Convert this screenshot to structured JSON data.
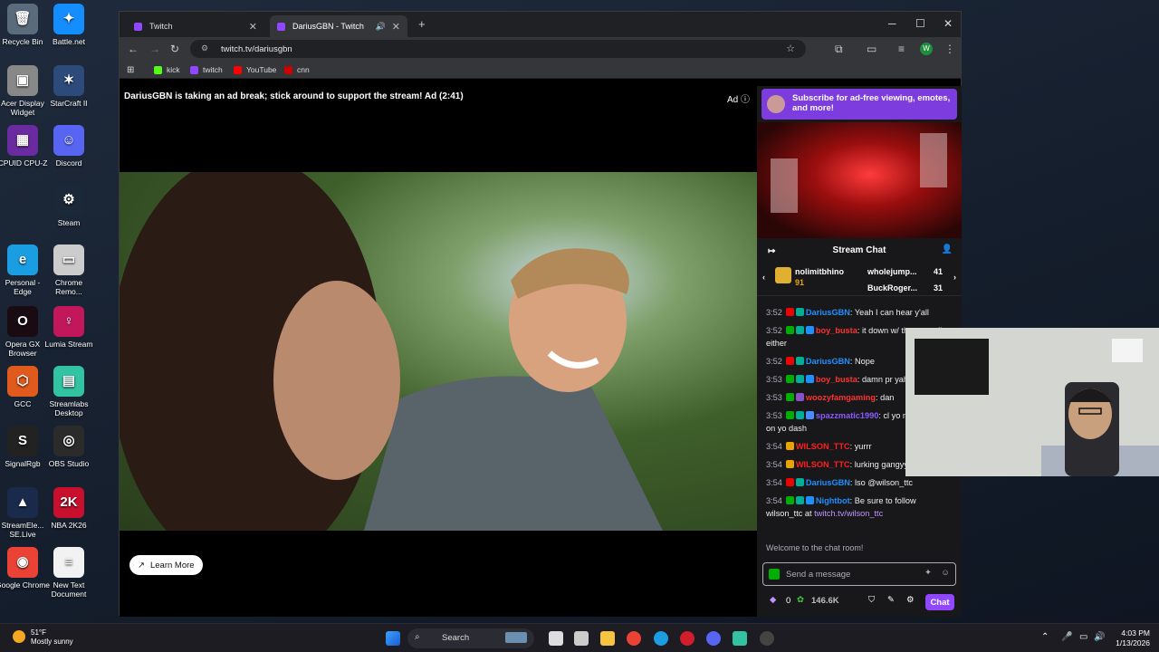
{
  "desktop": {
    "icons": [
      {
        "label": "Recycle Bin",
        "color": "#5a6b7d",
        "glyph": "🗑"
      },
      {
        "label": "Battle.net",
        "color": "#148eff",
        "glyph": "✦"
      },
      {
        "label": "Acer Display Widget",
        "color": "#888888",
        "glyph": "▣"
      },
      {
        "label": "StarCraft II",
        "color": "#2c4a7a",
        "glyph": "✶"
      },
      {
        "label": "CPUID CPU-Z",
        "color": "#6a2aa0",
        "glyph": "▦"
      },
      {
        "label": "Discord",
        "color": "#5865f2",
        "glyph": "☺"
      },
      {
        "label": "Steam",
        "color": "#1b2838",
        "glyph": "⚙"
      },
      {
        "label": "Personal - Edge",
        "color": "#1b9de2",
        "glyph": "e"
      },
      {
        "label": "Chrome Remo...",
        "color": "#cccccc",
        "glyph": "▭"
      },
      {
        "label": "Opera GX Browser",
        "color": "#1a0b12",
        "glyph": "O"
      },
      {
        "label": "Lumia Stream",
        "color": "#c2185b",
        "glyph": "♀"
      },
      {
        "label": "GCC",
        "color": "#e05a1e",
        "glyph": "⬡"
      },
      {
        "label": "Streamlabs Desktop",
        "color": "#31c3a2",
        "glyph": "▤"
      },
      {
        "label": "SignalRgb",
        "color": "#222222",
        "glyph": "S"
      },
      {
        "label": "OBS Studio",
        "color": "#2b2b2b",
        "glyph": "◎"
      },
      {
        "label": "StreamEle... SE.Live",
        "color": "#1a2a4a",
        "glyph": "▲"
      },
      {
        "label": "NBA 2K26",
        "color": "#c8102e",
        "glyph": "2K"
      },
      {
        "label": "Google Chrome",
        "color": "#ea4335",
        "glyph": "◉"
      },
      {
        "label": "New Text Document",
        "color": "#f2f2f2",
        "glyph": "≡"
      }
    ]
  },
  "browser": {
    "tabs": [
      {
        "label": "Twitch"
      },
      {
        "label": "DariusGBN - Twitch"
      }
    ],
    "url": "twitch.tv/dariusgbn",
    "bookmarks": [
      {
        "label": "kick",
        "color": "#53fc18"
      },
      {
        "label": "twitch",
        "color": "#9146ff"
      },
      {
        "label": "YouTube",
        "color": "#ff0000"
      },
      {
        "label": "cnn",
        "color": "#cc0000"
      }
    ],
    "profile_initial": "W"
  },
  "player": {
    "ad_message": "DariusGBN is taking an ad break; stick around to support the stream! Ad (2:41)",
    "ad_label": "Ad",
    "learn_more": "Learn More"
  },
  "sidebar": {
    "promo_text": "Subscribe for ad-free viewing, emotes, and more!",
    "chat_title": "Stream Chat",
    "gifts": {
      "left_name": "nolimitbhino",
      "left_count": "91",
      "top1_name": "wholejump...",
      "top1_count": "41",
      "top2_name": "BuckRoger...",
      "top2_count": "31"
    },
    "messages": [
      {
        "time": "3:52",
        "user": "DariusGBN",
        "color": "#1e90ff",
        "text": ": Yeah I can hear y'all",
        "badges": [
          "#eb0400",
          "#00ad96"
        ]
      },
      {
        "time": "3:52",
        "user": "boy_busta",
        "color": "#ff3131",
        "text": ": it down w/ the controller either",
        "badges": [
          "#00ad03",
          "#00ad96",
          "#1e90ff"
        ]
      },
      {
        "time": "3:52",
        "user": "DariusGBN",
        "color": "#1e90ff",
        "text": ": Nope",
        "badges": [
          "#eb0400",
          "#00ad96"
        ]
      },
      {
        "time": "3:53",
        "user": "boy_busta",
        "color": "#ff3131",
        "text": ": damn pr yah game then",
        "badges": [
          "#00ad03",
          "#00ad96",
          "#1e90ff"
        ]
      },
      {
        "time": "3:53",
        "user": "woozyfamgaming",
        "color": "#ff3131",
        "text": ": dan",
        "badges": [
          "#00ad03",
          "#8b4fc7"
        ]
      },
      {
        "time": "3:53",
        "user": "spazzmatic1990",
        "color": "#8a5cff",
        "text": ": cl yo mic settings on yo dash",
        "badges": [
          "#00ad03",
          "#00ad96",
          "#4a8cff"
        ]
      },
      {
        "time": "3:54",
        "user": "WILSON_TTC",
        "color": "#ff1f1f",
        "text": ": yurrr",
        "badges": [
          "#e8a400"
        ]
      },
      {
        "time": "3:54",
        "user": "WILSON_TTC",
        "color": "#ff1f1f",
        "text": ": lurking gangyy",
        "badges": [
          "#e8a400"
        ]
      },
      {
        "time": "3:54",
        "user": "DariusGBN",
        "color": "#1e90ff",
        "text": ": lso @wilson_ttc",
        "badges": [
          "#eb0400",
          "#00ad96"
        ]
      },
      {
        "time": "3:54",
        "user": "Nightbot",
        "color": "#1e90ff",
        "text": ": Be sure to follow wilson_ttc at ",
        "link": "twitch.tv/wilson_ttc",
        "badges": [
          "#00ad03",
          "#00ad96",
          "#1e90ff"
        ]
      }
    ],
    "welcome": "Welcome to the chat room!",
    "input_placeholder": "Send a message",
    "points": "0",
    "channel_points": "146.6K",
    "chat_button": "Chat"
  },
  "taskbar": {
    "weather_temp": "51°F",
    "weather_desc": "Mostly sunny",
    "search_label": "Search",
    "time": "4:03 PM",
    "date": "1/13/2026"
  }
}
